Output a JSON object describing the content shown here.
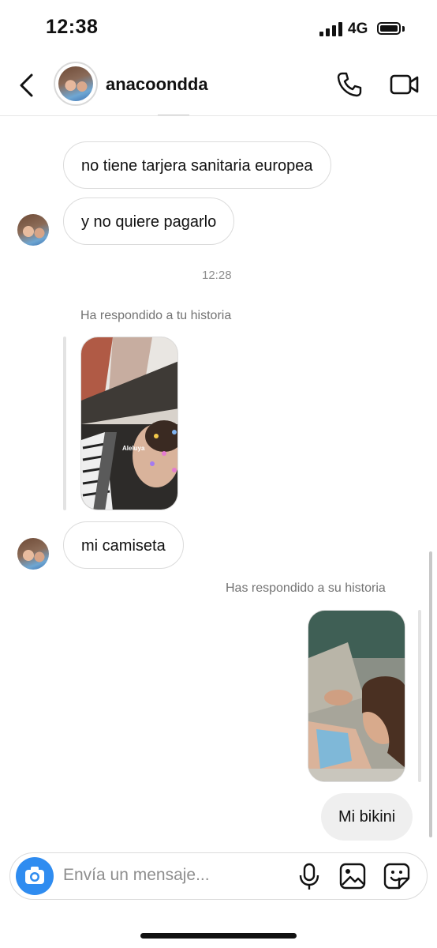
{
  "status": {
    "time": "12:38",
    "network": "4G"
  },
  "header": {
    "username": "anacoondda"
  },
  "messages": {
    "m1": "no tiene tarjera sanitaria europea",
    "m2": "y no quiere pagarlo",
    "timestamp": "12:28",
    "reply_note_in": "Ha respondido a tu historia",
    "story_sticker": "Aleluya",
    "m3": "mi camiseta",
    "reply_note_out": "Has respondido a su historia",
    "m4": "Mi bikini"
  },
  "composer": {
    "placeholder": "Envía un mensaje..."
  },
  "colors": {
    "accent": "#2f8cf0",
    "bubble_out": "#efefef",
    "border": "#dbdbdb"
  }
}
